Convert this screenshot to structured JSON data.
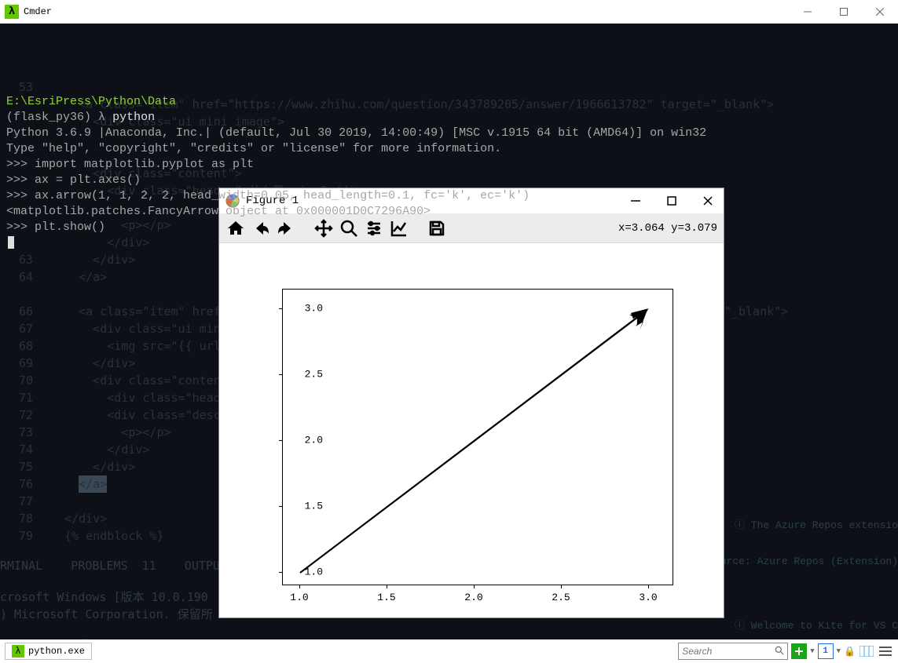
{
  "window": {
    "title": "Cmder",
    "min_label": "-",
    "max_label": "□",
    "close_label": "×"
  },
  "terminal": {
    "cwd": "E:\\EsriPress\\Python\\Data",
    "venv": "(flask_py36)",
    "prompt_symbol": "λ",
    "cmd": "python",
    "banner1": "Python 3.6.9 |Anaconda, Inc.| (default, Jul 30 2019, 14:00:49) [MSC v.1915 64 bit (AMD64)] on win32",
    "banner2": "Type \"help\", \"copyright\", \"credits\" or \"license\" for more information.",
    "lines": [
      ">>> import matplotlib.pyplot as plt",
      ">>> ax = plt.axes()",
      ">>> ax.arrow(1, 1, 2, 2, head_width=0.05, head_length=0.1, fc='k', ec='k')",
      "<matplotlib.patches.FancyArrow object at 0x000001D0C7296A90>",
      ">>> plt.show()"
    ]
  },
  "figure": {
    "title": "Figure 1",
    "coords": "x=3.064 y=3.079",
    "yticks": [
      "1.0",
      "1.5",
      "2.0",
      "2.5",
      "3.0"
    ],
    "xticks": [
      "1.0",
      "1.5",
      "2.0",
      "2.5",
      "3.0"
    ]
  },
  "statusbar": {
    "tab": "python.exe",
    "search_placeholder": "Search"
  },
  "notif": {
    "line1": "The Azure Repos extensio",
    "line2": "Source: Azure Repos (Extension)",
    "line3": "Welcome to Kite for VS C"
  },
  "chart_data": {
    "type": "line",
    "description": "matplotlib arrow from (1,1) to (3,3)",
    "x": [
      1.0,
      3.0
    ],
    "y": [
      1.0,
      3.0
    ],
    "arrow": {
      "start": [
        1.0,
        1.0
      ],
      "delta": [
        2.0,
        2.0
      ],
      "head_width": 0.05,
      "head_length": 0.1,
      "fc": "k",
      "ec": "k"
    },
    "xlim": [
      0.9,
      3.15
    ],
    "ylim": [
      0.9,
      3.15
    ],
    "xticks": [
      1.0,
      1.5,
      2.0,
      2.5,
      3.0
    ],
    "yticks": [
      1.0,
      1.5,
      2.0,
      2.5,
      3.0
    ]
  }
}
